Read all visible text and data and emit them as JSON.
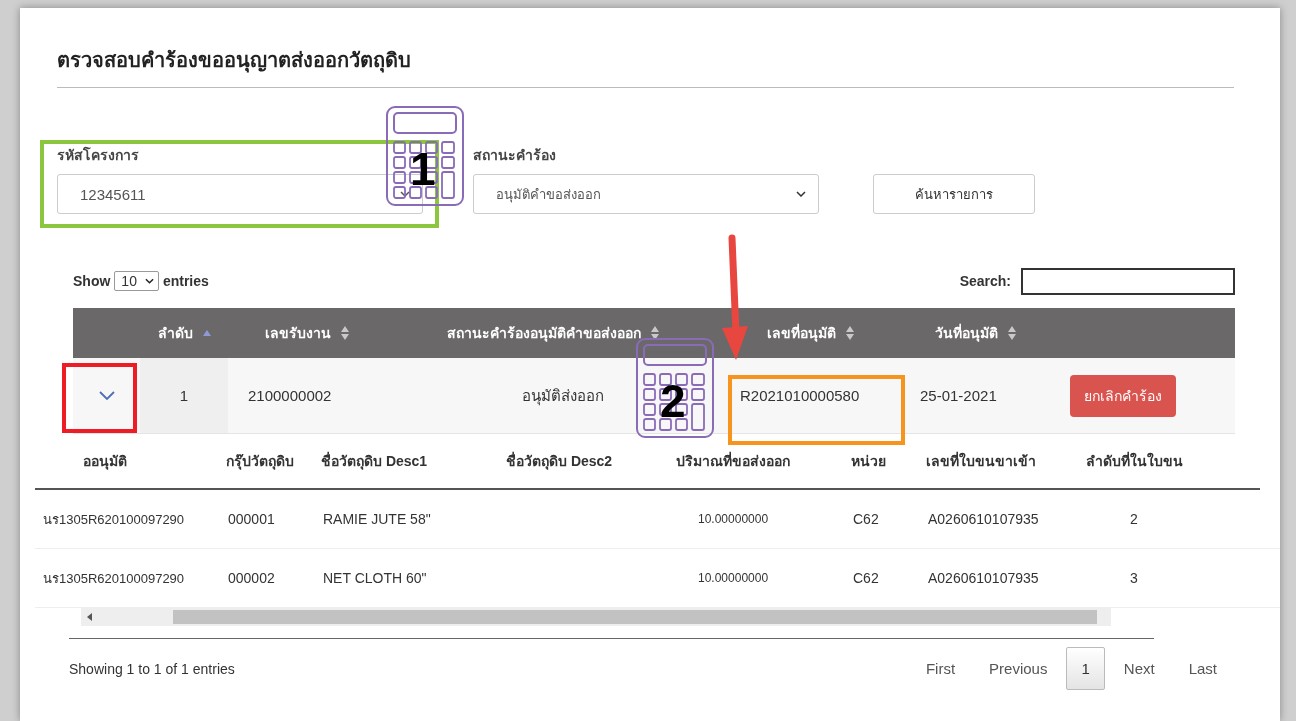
{
  "title": "ตรวจสอบคำร้องขออนุญาตส่งออกวัตถุดิบ",
  "filters": {
    "project_code": {
      "label": "รหัสโครงการ",
      "value": "12345611"
    },
    "status": {
      "label": "สถานะคำร้อง",
      "value": "อนุมัติคำขอส่งออก"
    },
    "search_button": "ค้นหารายการ"
  },
  "table": {
    "show_label": "Show",
    "page_length": "10",
    "entries_label": "entries",
    "search_label": "Search:",
    "columns": [
      {
        "label": "ลำดับ",
        "sorted": true
      },
      {
        "label": "เลขรับงาน",
        "sorted": false
      },
      {
        "label": "สถานะคำร้องอนุมัติคำขอส่งออก",
        "sorted": false
      },
      {
        "label": "เลขที่อนุมัติ",
        "sorted": false
      },
      {
        "label": "วันที่อนุมัติ",
        "sorted": false
      }
    ],
    "rows": [
      {
        "expanded": true,
        "cells": [
          "1",
          "2100000002",
          "อนุมัติส่งออก",
          "R2021010000580",
          "25-01-2021"
        ],
        "action": "ยกเลิกคำร้อง"
      }
    ]
  },
  "detail": {
    "columns": [
      "ออนุมัติ",
      "กรุ๊ปวัตถุดิบ",
      "ชื่อวัตถุดิบ Desc1",
      "ชื่อวัตถุดิบ Desc2",
      "ปริมาณที่ขอส่งออก",
      "หน่วย",
      "เลขที่ใบขนขาเข้า",
      "ลำดับที่ในใบขน"
    ],
    "rows": [
      [
        "นร1305R620100097290",
        "000001",
        "RAMIE JUTE 58\"",
        "",
        "10.00000000",
        "C62",
        "A0260610107935",
        "2"
      ],
      [
        "นร1305R620100097290",
        "000002",
        "NET CLOTH 60\"",
        "",
        "10.00000000",
        "C62",
        "A0260610107935",
        "3"
      ]
    ]
  },
  "footer": {
    "info": "Showing 1 to 1 of 1 entries",
    "pagination": [
      {
        "label": "First",
        "selected": false
      },
      {
        "label": "Previous",
        "selected": false
      },
      {
        "label": "1",
        "selected": true
      },
      {
        "label": "Next",
        "selected": false
      },
      {
        "label": "Last",
        "selected": false
      }
    ]
  },
  "annotations": {
    "markers": [
      {
        "number": "1"
      },
      {
        "number": "2"
      }
    ],
    "highlights": [
      {
        "color": "#8cc63f"
      },
      {
        "color": "#ee1c24"
      },
      {
        "color": "#f7941d"
      }
    ]
  }
}
